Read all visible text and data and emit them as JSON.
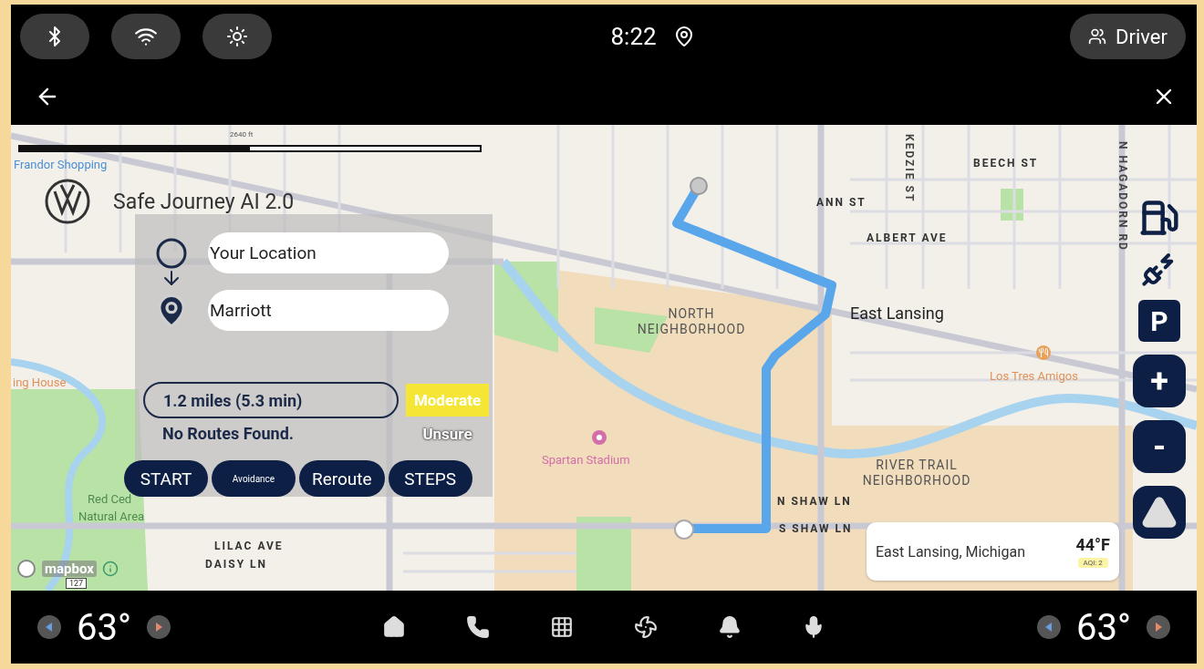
{
  "status_bar": {
    "time": "8:22",
    "profile": "Driver"
  },
  "map": {
    "scale_label": "2640 ft",
    "attribution": "mapbox",
    "highway_shield": "127",
    "labels": [
      {
        "text": "Frandor Shopping",
        "kind": "poi"
      },
      {
        "text": "ing House",
        "kind": "food"
      },
      {
        "text": "Red Ced",
        "kind": "park"
      },
      {
        "text": "Natural Area",
        "kind": "park"
      },
      {
        "text": "BEECH ST",
        "kind": "street"
      },
      {
        "text": "ANN ST",
        "kind": "street"
      },
      {
        "text": "ALBERT AVE",
        "kind": "street"
      },
      {
        "text": "KEDZIE ST",
        "kind": "vertical"
      },
      {
        "text": "N HAGADORN RD",
        "kind": "vertical"
      },
      {
        "text": "NORTH NEIGHBORHOOD",
        "kind": "area"
      },
      {
        "text": "East Lansing",
        "kind": "city"
      },
      {
        "text": "Los Tres Amigos",
        "kind": "food"
      },
      {
        "text": "Spartan Stadium",
        "kind": "venue"
      },
      {
        "text": "RIVER TRAIL NEIGHBORHOOD",
        "kind": "area"
      },
      {
        "text": "N SHAW LN",
        "kind": "street"
      },
      {
        "text": "S SHAW LN",
        "kind": "street"
      },
      {
        "text": "LILAC AVE",
        "kind": "street"
      },
      {
        "text": "DAISY LN",
        "kind": "street"
      }
    ]
  },
  "journey_panel": {
    "title": "Safe Journey AI 2.0",
    "origin": {
      "value": "Your Location"
    },
    "destination": {
      "value": "Marriott"
    },
    "distance": "1.2 miles (5.3 min)",
    "route_status": "No Routes Found.",
    "safety_rating": "Moderate",
    "confidence": "Unsure",
    "buttons": [
      {
        "label": "START",
        "kind": "normal"
      },
      {
        "label": "Avoidance",
        "kind": "compact"
      },
      {
        "label": "Reroute",
        "kind": "normal"
      },
      {
        "label": "STEPS",
        "kind": "normal"
      }
    ]
  },
  "map_controls": [
    {
      "label": "P",
      "kind": "square"
    },
    {
      "label": "+",
      "kind": "round"
    },
    {
      "label": "-",
      "kind": "round"
    }
  ],
  "weather": {
    "location": "East Lansing, Michigan",
    "temperature": "44°F",
    "aqi": "AQI: 2"
  },
  "climate": {
    "left_temperature": "63°",
    "right_temperature": "63°"
  }
}
